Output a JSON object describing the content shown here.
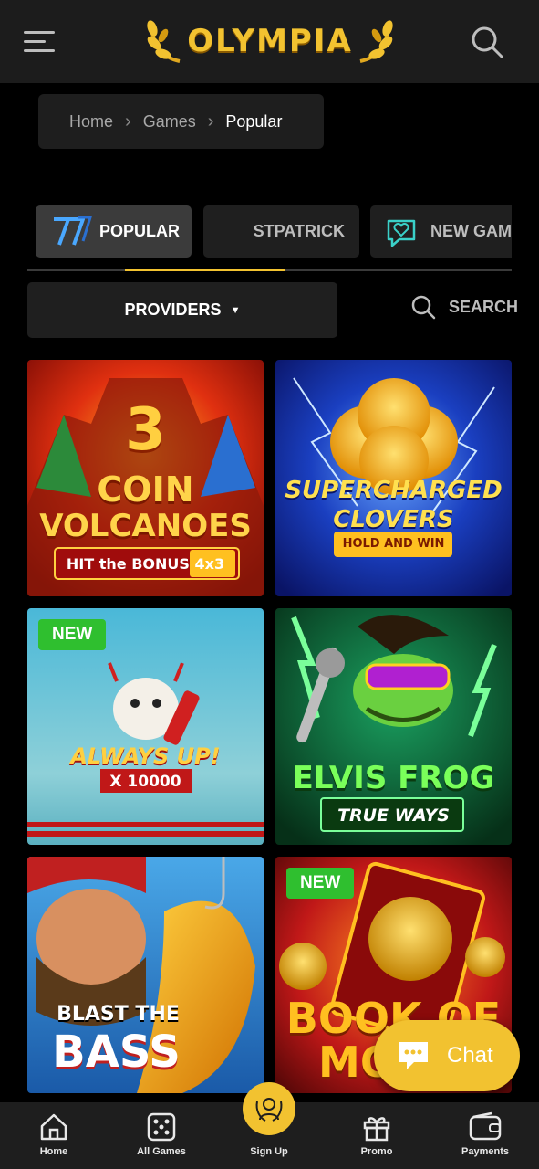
{
  "header": {
    "logo_text": "OLYMPIA",
    "menu_icon": "hamburger-icon",
    "search_icon": "search-icon"
  },
  "breadcrumb": {
    "items": [
      "Home",
      "Games",
      "Popular"
    ]
  },
  "tabs": [
    {
      "label": "POPULAR",
      "icon": "sevens-icon",
      "active": true
    },
    {
      "label": "STPATRICK",
      "icon": "",
      "active": false
    },
    {
      "label": "NEW GAME",
      "icon": "heart-chat-icon",
      "active": false
    }
  ],
  "filters": {
    "providers_label": "PROVIDERS",
    "search_label": "SEARCH"
  },
  "games": [
    {
      "title_line1": "3",
      "title_line2": "COIN",
      "title_line3": "VOLCANOES",
      "subtitle": "HIT the BONUS 4x3",
      "badge": ""
    },
    {
      "title_line1": "SUPERCHARGED",
      "title_line2": "CLOVERS",
      "subtitle": "HOLD AND WIN",
      "badge": ""
    },
    {
      "title_line1": "ALWAYS UP!",
      "subtitle": "X 10000",
      "badge": "NEW"
    },
    {
      "title_line1": "ELVIS FROG",
      "subtitle": "TRUE WAYS",
      "badge": ""
    },
    {
      "title_line1": "BLAST THE",
      "title_line2": "BASS",
      "badge": ""
    },
    {
      "title_line1": "BOOK OF",
      "title_line2": "MO",
      "badge": "NEW"
    }
  ],
  "chat": {
    "label": "Chat"
  },
  "bottom_nav": {
    "home": "Home",
    "all_games": "All Games",
    "sign_up": "Sign Up",
    "promo": "Promo",
    "payments": "Payments"
  },
  "colors": {
    "accent": "#f2c230",
    "badge_new": "#2fbf2f",
    "background": "#000000",
    "surface": "#1f1f1f"
  }
}
